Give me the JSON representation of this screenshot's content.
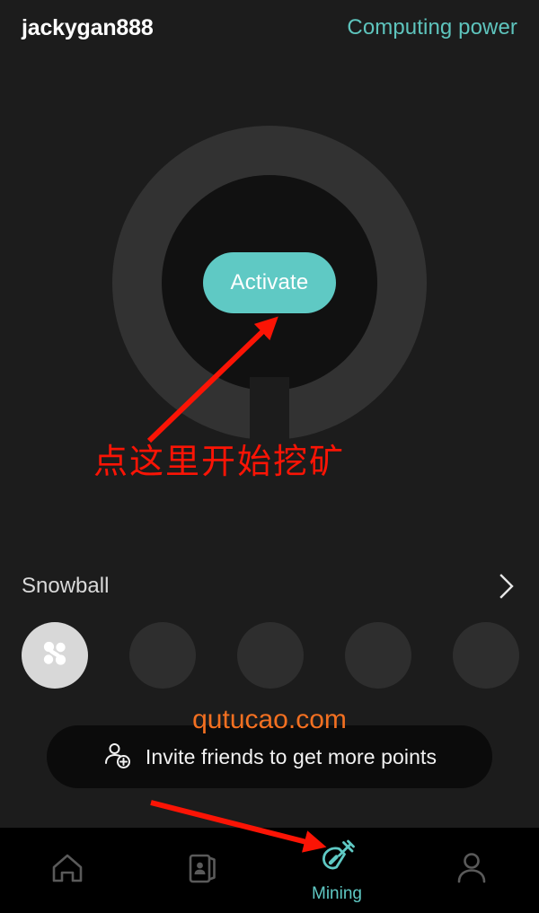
{
  "header": {
    "username": "jackygan888",
    "computing_power_label": "Computing power"
  },
  "dial": {
    "activate_label": "Activate"
  },
  "annotations": {
    "mining_hint": "点这里开始挖矿",
    "arrow_to_activate": "red-arrow",
    "arrow_to_mining_tab": "red-arrow"
  },
  "snowball": {
    "title": "Snowball",
    "chevron": "chevron-right-icon",
    "slots": [
      {
        "state": "filled",
        "icon": "snowball-node-icon"
      },
      {
        "state": "empty",
        "icon": ""
      },
      {
        "state": "empty",
        "icon": ""
      },
      {
        "state": "empty",
        "icon": ""
      },
      {
        "state": "empty",
        "icon": ""
      }
    ]
  },
  "invite": {
    "label": "Invite friends to get more points",
    "icon": "person-add-icon"
  },
  "watermark": {
    "text": "qutucao.com"
  },
  "bottom_nav": {
    "items": [
      {
        "label": "",
        "icon": "home-icon",
        "active": false
      },
      {
        "label": "",
        "icon": "contact-card-icon",
        "active": false
      },
      {
        "label": "Mining",
        "icon": "shovel-icon",
        "active": true
      },
      {
        "label": "",
        "icon": "person-icon",
        "active": false
      }
    ]
  },
  "colors": {
    "accent_teal": "#5fc9c4",
    "annotation_red": "#fb1405",
    "watermark_orange": "#f37021",
    "page_background": "#1c1c1c",
    "nav_background": "#000000"
  }
}
